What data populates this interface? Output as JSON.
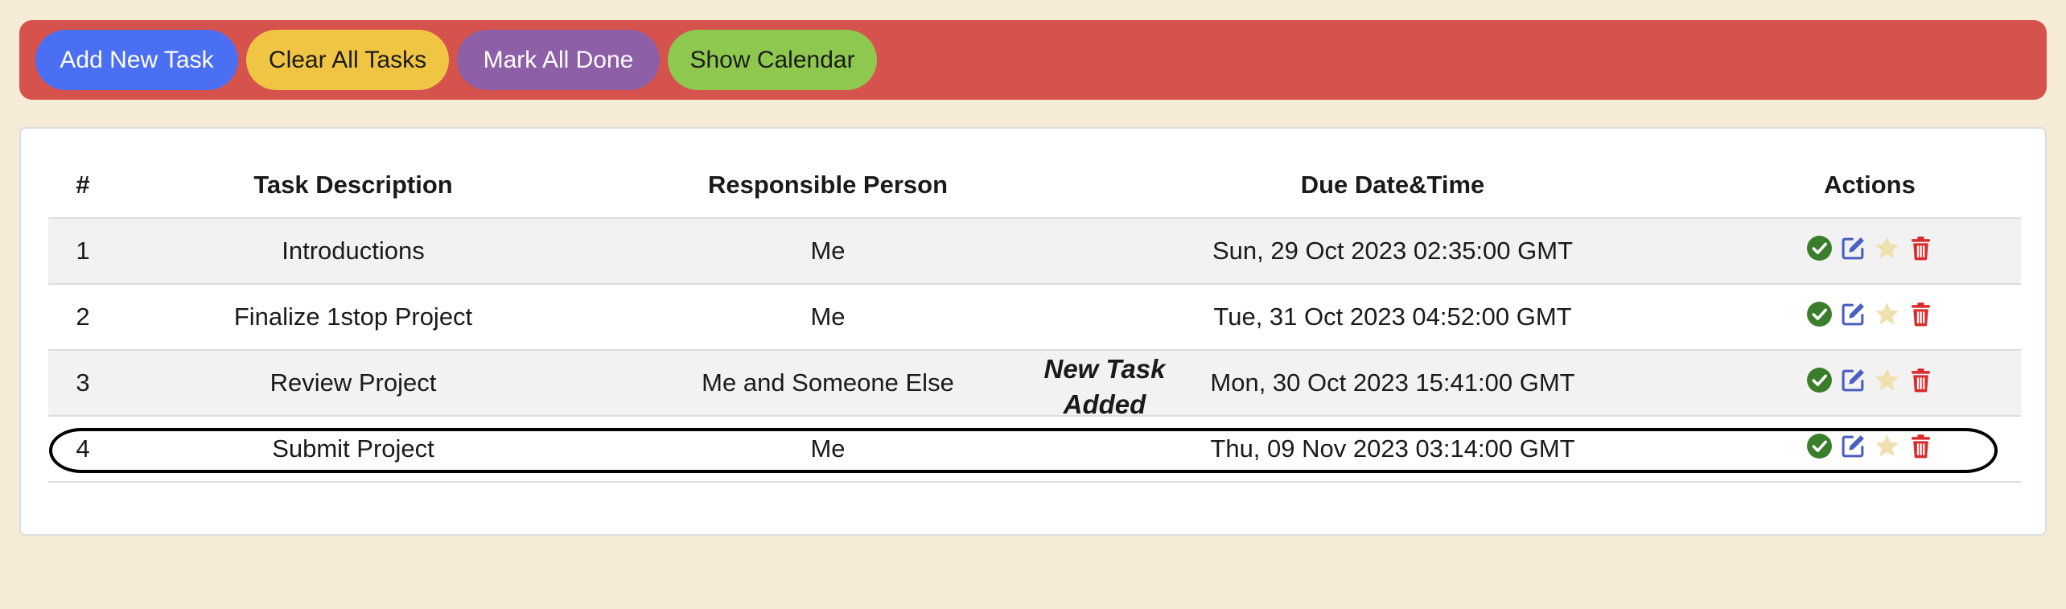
{
  "toolbar": {
    "add_label": "Add New Task",
    "clear_label": "Clear All Tasks",
    "mark_label": "Mark All Done",
    "calendar_label": "Show Calendar"
  },
  "colors": {
    "toolbar_bg": "#d6534d",
    "add_button": "#4b6ff2",
    "clear_button": "#f0c544",
    "mark_button": "#8d5fa6",
    "calendar_button": "#8fc84f",
    "done_icon": "#3a7d2a",
    "edit_icon": "#4a5fc1",
    "star_icon": "#f0e0b0",
    "delete_icon": "#d92b2b"
  },
  "table": {
    "headers": {
      "num": "#",
      "desc": "Task Description",
      "person": "Responsible Person",
      "date": "Due Date&Time",
      "actions": "Actions"
    },
    "rows": [
      {
        "num": "1",
        "desc": "Introductions",
        "person": "Me",
        "date": "Sun, 29 Oct 2023 02:35:00 GMT"
      },
      {
        "num": "2",
        "desc": "Finalize 1stop Project",
        "person": "Me",
        "date": "Tue, 31 Oct 2023 04:52:00 GMT"
      },
      {
        "num": "3",
        "desc": "Review Project",
        "person": "Me and Someone Else",
        "date": "Mon, 30 Oct 2023 15:41:00 GMT"
      },
      {
        "num": "4",
        "desc": "Submit Project",
        "person": "Me",
        "date": "Thu, 09 Nov 2023 03:14:00 GMT"
      }
    ],
    "row_icons": [
      "check-circle-icon",
      "edit-icon",
      "star-icon",
      "trash-icon"
    ]
  },
  "annotation": {
    "line1": "New Task",
    "line2": "Added"
  }
}
